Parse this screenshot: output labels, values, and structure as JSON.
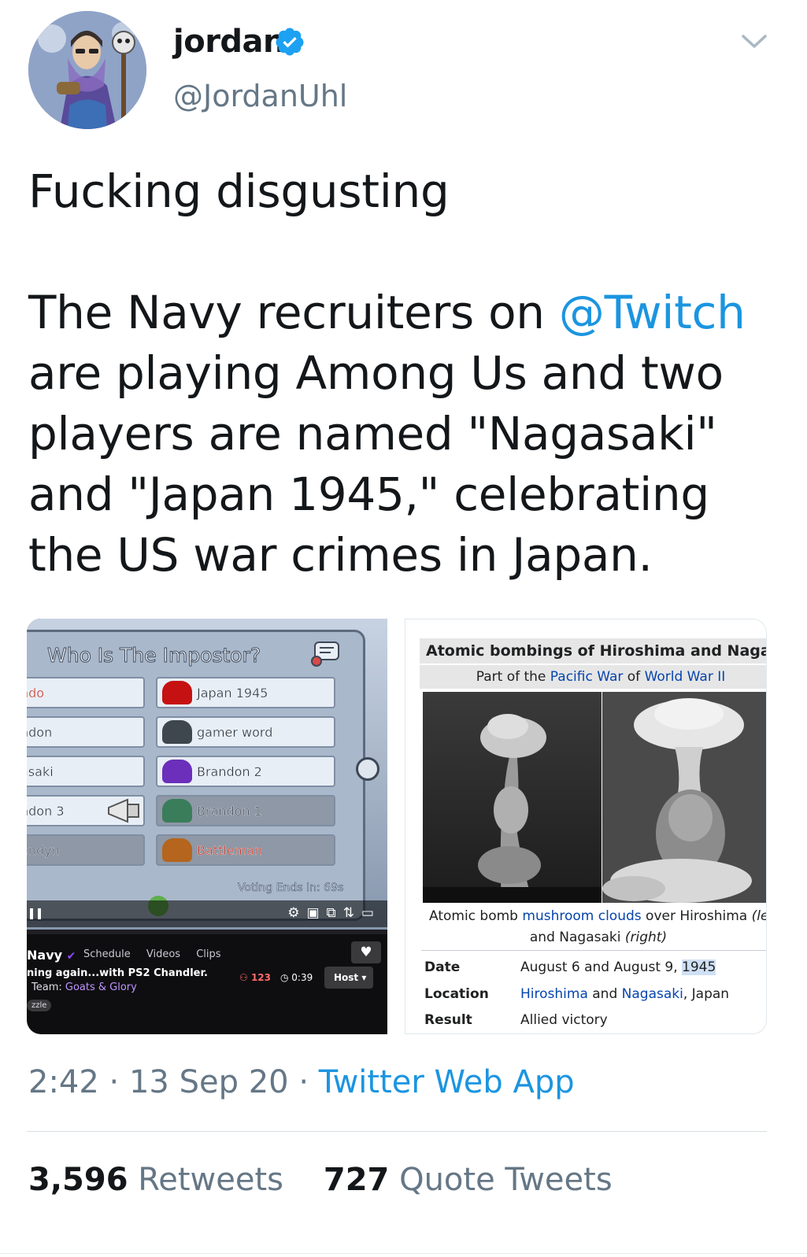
{
  "author": {
    "display_name": "jordan",
    "handle": "@JordanUhl",
    "verified_icon": "verified-badge-icon",
    "avatar_icon": "avatar-illustration-icon"
  },
  "tweet": {
    "line1": "Fucking disgusting",
    "body_before_mention": "The Navy recruiters on ",
    "mention": "@Twitch",
    "body_after_mention": "\nare playing Among Us and two players are named \"Nagasaki\" and \"Japan 1945,\" celebrating the US war crimes in Japan."
  },
  "game_screenshot": {
    "title": "Who Is The Impostor?",
    "rows_left": [
      "ndo",
      "ndon",
      "asaki",
      "ndon 3",
      "endyn"
    ],
    "rows_right": [
      "Japan 1945",
      "gamer word",
      "Brandon 2",
      "Brandon 1",
      "Battleman"
    ],
    "voting_ends": "Voting Ends In: 69s",
    "channel": "Navy",
    "tabs": "Schedule Videos Clips",
    "stream_title": "ning again...with PS2 Chandler.",
    "team_label": "Team: ",
    "team_name": "Goats & Glory",
    "tag": "zzle",
    "viewers": "123",
    "uptime": "0:39",
    "host_label": "Host"
  },
  "wiki_screenshot": {
    "title": "Atomic bombings of Hiroshima and Nagasak",
    "sub_prefix": "Part of the ",
    "sub_link1": "Pacific War",
    "sub_mid": " of ",
    "sub_link2": "World War II",
    "caption_pre": "Atomic bomb ",
    "caption_link": "mushroom clouds",
    "caption_mid": " over Hiroshima ",
    "caption_left": "(left",
    "caption_line2_pre": "and Nagasaki ",
    "caption_right": "(right)",
    "date_label": "Date",
    "date_value_pre": "August 6 and August 9, ",
    "date_value_year": "1945",
    "location_label": "Location",
    "location_link1": "Hiroshima",
    "location_and": " and ",
    "location_link2": "Nagasaki",
    "location_suffix": ", Japan",
    "result_label": "Result",
    "result_value": "Allied victory"
  },
  "meta": {
    "time": "2:42",
    "sep1": " · ",
    "date": "13 Sep 20",
    "sep2": " · ",
    "source": "Twitter Web App"
  },
  "stats": {
    "retweets_count": "3,596",
    "retweets_label": "Retweets",
    "quotes_count": "727",
    "quotes_label": "Quote Tweets"
  },
  "colors": {
    "link": "#1b95e0",
    "text": "#14171a",
    "secondary": "#657786",
    "wiki_link": "#0645ad"
  }
}
